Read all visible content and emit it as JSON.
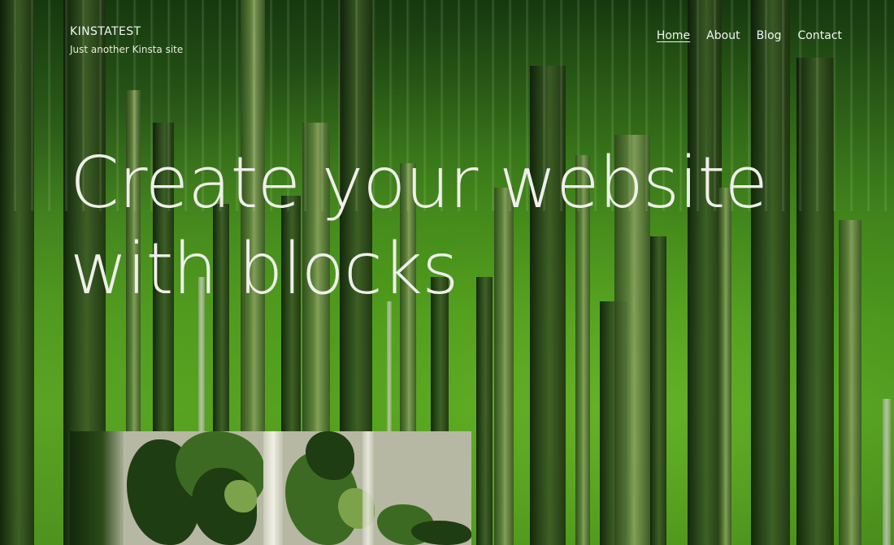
{
  "site": {
    "title": "KINSTATEST",
    "tagline": "Just another Kinsta site"
  },
  "nav": {
    "items": [
      {
        "label": "Home",
        "current": true
      },
      {
        "label": "About",
        "current": false
      },
      {
        "label": "Blog",
        "current": false
      },
      {
        "label": "Contact",
        "current": false
      }
    ]
  },
  "hero": {
    "heading_line1": "Create your website",
    "heading_line2": "with blocks"
  },
  "colors": {
    "text": "#efefea",
    "background_green": "#4f9622",
    "trunk_dark": "#1d3010"
  }
}
